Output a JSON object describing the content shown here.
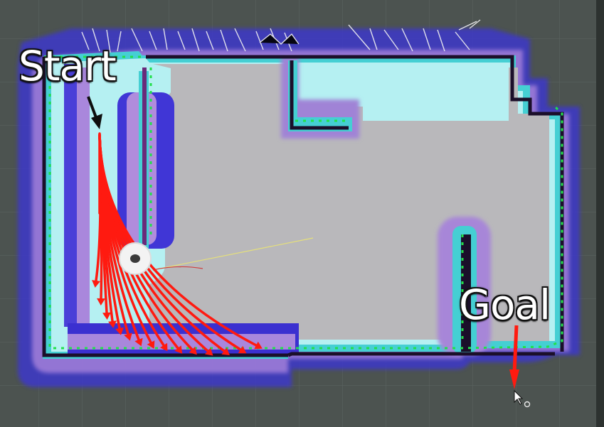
{
  "labels": {
    "start": "Start",
    "goal": "Goal"
  },
  "icons": {
    "robot": "robot-icon",
    "cursor": "mouse-pointer-icon",
    "arrow": "arrow-down-icon"
  },
  "colors": {
    "background": "#4c5350",
    "grid": "#5d6562",
    "free_space": "#b9b8bb",
    "inflation_outer": "#4a3fd8",
    "inflation_mid": "#b98cd9",
    "inflation_cyan": "#43d2d6",
    "obstacle": "#1b0f2a",
    "path": "#22e04a",
    "pose_arrow": "#ff1a10",
    "label_text": "#ffffff"
  }
}
